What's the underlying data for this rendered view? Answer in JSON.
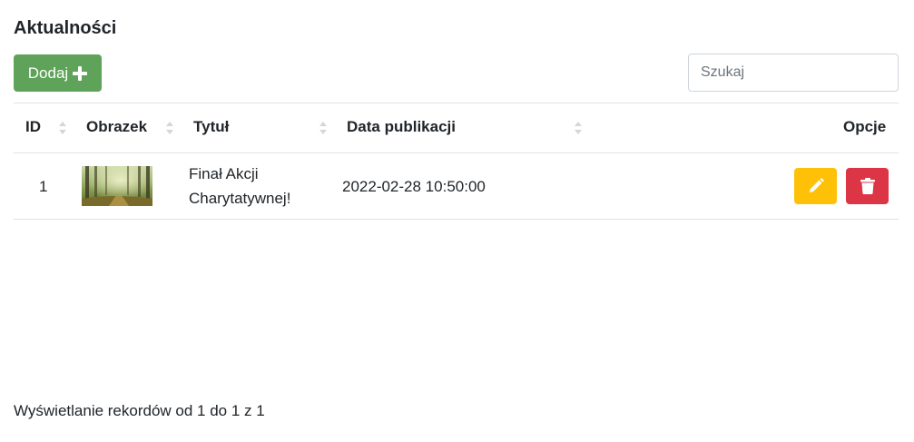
{
  "page": {
    "title": "Aktualności"
  },
  "toolbar": {
    "add_label": "Dodaj",
    "search_placeholder": "Szukaj",
    "search_value": ""
  },
  "table": {
    "headers": {
      "id": "ID",
      "image": "Obrazek",
      "title": "Tytuł",
      "date": "Data publikacji",
      "options": "Opcje"
    },
    "rows": [
      {
        "id": "1",
        "title_line1": "Finał Akcji",
        "title_line2": "Charytatywnej!",
        "date": "2022-02-28 10:50:00"
      }
    ]
  },
  "footer": {
    "info": "Wyświetlanie rekordów od 1 do 1 z 1"
  },
  "colors": {
    "add": "#5fa35a",
    "edit": "#ffc107",
    "delete": "#dc3545"
  }
}
